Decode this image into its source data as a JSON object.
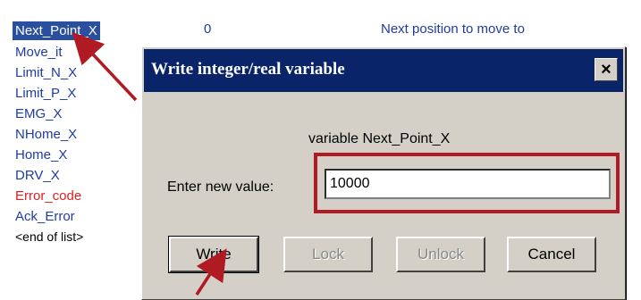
{
  "variable_list": {
    "items": [
      {
        "label": "Next_Point_X",
        "state": "selected"
      },
      {
        "label": "Move_it",
        "state": "normal"
      },
      {
        "label": "Limit_N_X",
        "state": "normal"
      },
      {
        "label": "Limit_P_X",
        "state": "normal"
      },
      {
        "label": "EMG_X",
        "state": "normal"
      },
      {
        "label": "NHome_X",
        "state": "normal"
      },
      {
        "label": "Home_X",
        "state": "normal"
      },
      {
        "label": "DRV_X",
        "state": "normal"
      },
      {
        "label": "Error_code",
        "state": "error"
      },
      {
        "label": "Ack_Error",
        "state": "normal"
      },
      {
        "label": "<end of list>",
        "state": "end"
      }
    ],
    "selected_value": "0",
    "selected_description": "Next position to move to"
  },
  "dialog": {
    "title": "Write integer/real variable",
    "close_symbol": "×",
    "variable_caption": "variable Next_Point_X",
    "enter_label": "Enter new value:",
    "input_value": "10000",
    "buttons": {
      "write": {
        "label": "Write",
        "mnemonic": "r",
        "enabled": true
      },
      "lock": {
        "label": "Lock",
        "mnemonic": "L",
        "enabled": false
      },
      "unlock": {
        "label": "Unlock",
        "mnemonic": "U",
        "enabled": false
      },
      "cancel": {
        "label": "Cancel",
        "mnemonic": "C",
        "enabled": true
      }
    }
  },
  "colors": {
    "annotation_red": "#b01a22",
    "title_bar": "#0a246a",
    "dialog_face": "#d4d0c8",
    "list_blue": "#1e3ca0",
    "list_red": "#e02020"
  }
}
